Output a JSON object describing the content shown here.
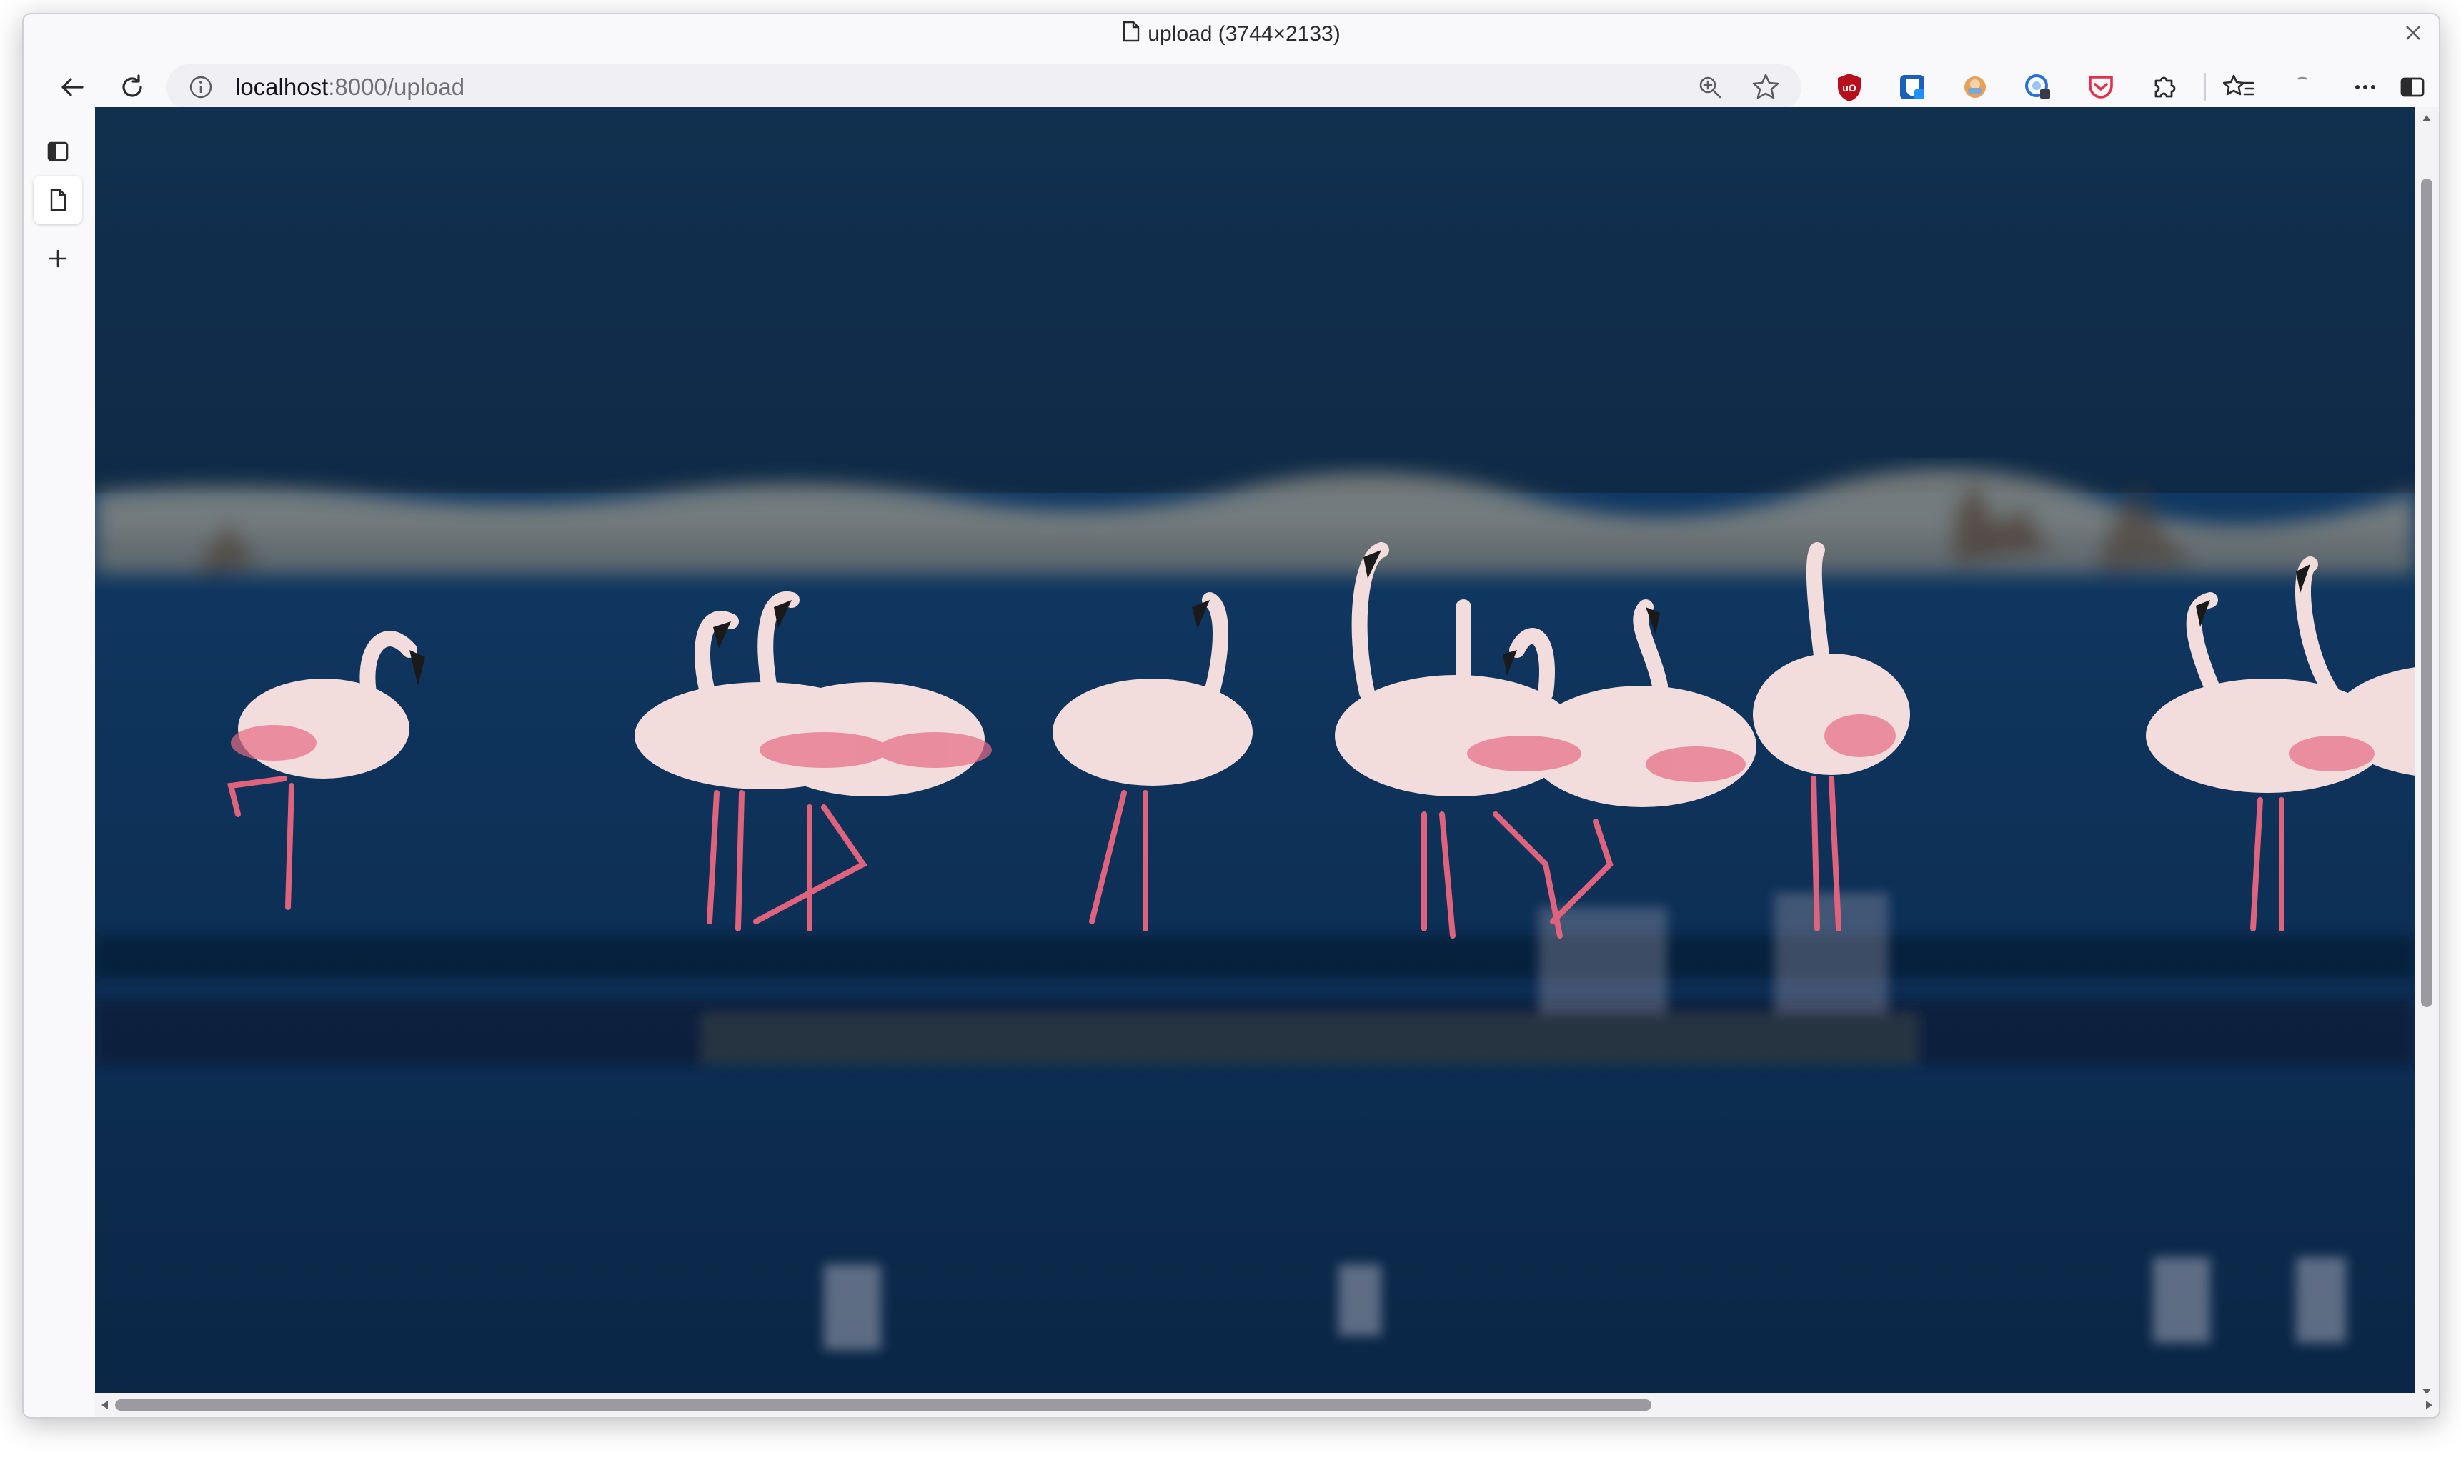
{
  "window": {
    "title": "upload (3744×2133)"
  },
  "navbar": {
    "url_host": "localhost",
    "url_path": ":8000/upload"
  },
  "extensions": [
    "ublock-origin-icon",
    "bitwarden-icon",
    "avatar-extension-icon",
    "privacy-extension-icon",
    "pocket-icon",
    "puzzle-extensions-icon"
  ],
  "content": {
    "image_description_colors": {
      "sky": "#0b2a4a",
      "water": "#123a66",
      "flamingo": "#f3dcdc",
      "flamingo_legs": "#e0637d"
    }
  }
}
